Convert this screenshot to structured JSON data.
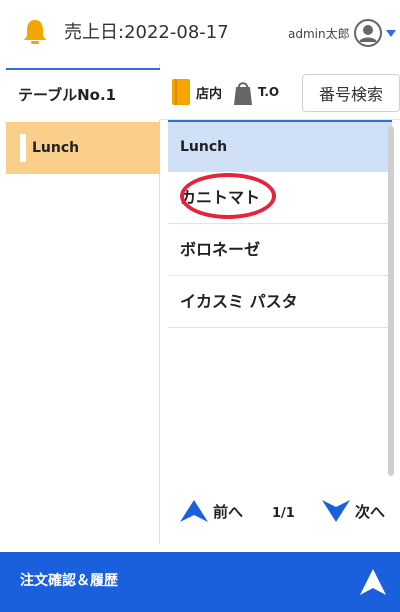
{
  "header": {
    "sales_date": "売上日:2022-08-17",
    "user_name": "admin太郎",
    "icons": {
      "bell": "bell-icon",
      "avatar": "user-avatar-icon",
      "caret": "chevron-down-icon"
    },
    "colors": {
      "bell": "#f4a500",
      "accent": "#2f6fd6"
    }
  },
  "left": {
    "table_tab": "テーブルNo.1",
    "categories": [
      {
        "label": "Lunch",
        "selected": true
      }
    ],
    "colors": {
      "selected_bg": "#f9cf8a"
    }
  },
  "toolbar": {
    "dine_in": "店内",
    "take_out": "T.O",
    "search": "番号検索",
    "colors": {
      "dine_in_icon": "#f4a500",
      "take_out_icon": "#666666"
    }
  },
  "menu": {
    "header": "Lunch",
    "items": [
      "カニトマト",
      "ボロネーゼ",
      "イカスミ パスタ"
    ],
    "colors": {
      "header_bg": "#cfe0f7",
      "highlight_circle": "#e5243b"
    }
  },
  "pager": {
    "prev": "前へ",
    "page": "1/1",
    "next": "次へ",
    "colors": {
      "arrow": "#1a5fdc"
    }
  },
  "footer": {
    "label": "注文確認＆履歴",
    "colors": {
      "bg": "#1a5fdc"
    }
  }
}
